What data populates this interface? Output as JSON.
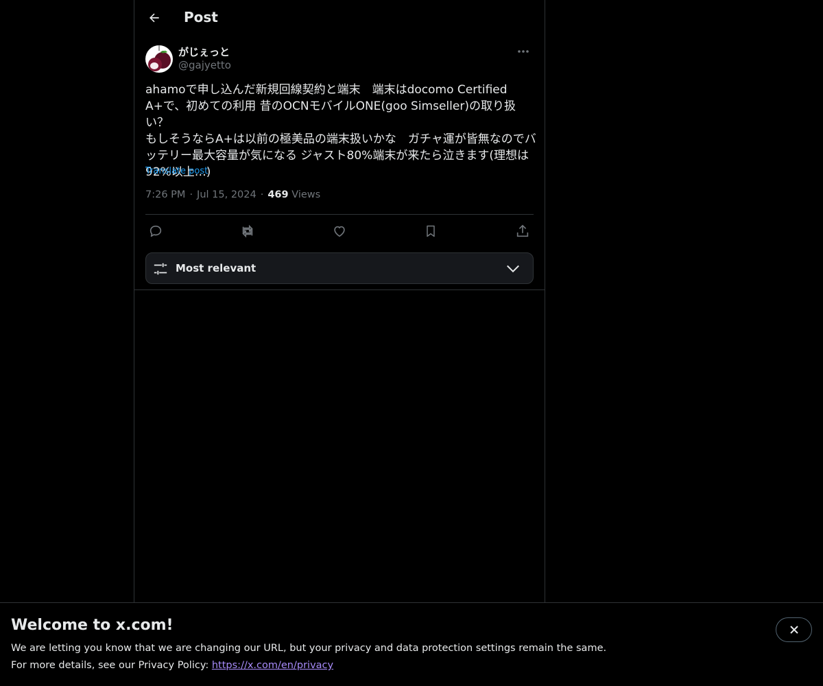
{
  "header": {
    "title": "Post",
    "back_icon": "arrow-left-icon"
  },
  "post": {
    "author": {
      "display_name": "がじぇっと",
      "handle": "@gajyetto",
      "avatar_icon": "mangosteen-avatar"
    },
    "text": "ahamoで申し込んだ新規回線契約と端末　端末はdocomo Certified\nA+で、初めての利用 昔のOCNモバイルONE(goo Simseller)の取り扱い？\nもしそうならA+は以前の極美品の端末扱いかな　ガチャ運が皆無なのでバ\nッテリー最大容量が気になる ジャスト80%端末が来たら泣きます(理想は\n92%以上…)",
    "translate_label": "Translate post",
    "time": "7:26 PM",
    "date": "Jul 15, 2024",
    "views_count": "469",
    "views_label": "Views",
    "separator": "·"
  },
  "actions": [
    {
      "name": "reply",
      "icon": "reply-icon"
    },
    {
      "name": "repost",
      "icon": "repost-icon"
    },
    {
      "name": "like",
      "icon": "heart-icon"
    },
    {
      "name": "bookmark",
      "icon": "bookmark-icon"
    },
    {
      "name": "share",
      "icon": "share-icon"
    }
  ],
  "sort": {
    "label": "Most relevant",
    "icon": "sliders-icon",
    "chevron": "chevron-down-icon"
  },
  "banner": {
    "title": "Welcome to x.com!",
    "line1": "We are letting you know that we are changing our URL, but your privacy and data protection settings remain the same.",
    "line2_prefix": "For more details, see our Privacy Policy: ",
    "link": "https://x.com/en/privacy",
    "close_icon": "close-icon"
  },
  "colors": {
    "background": "#000000",
    "text": "#e7e9ea",
    "muted": "#71767b",
    "accent": "#1d9bf0",
    "border": "#2f3336",
    "link_visited": "#a78bfa"
  }
}
